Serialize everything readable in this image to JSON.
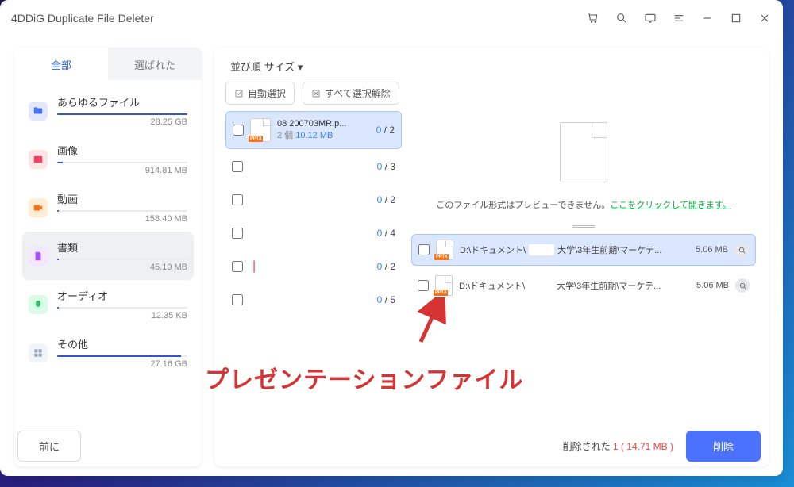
{
  "app": {
    "title": "4DDiG Duplicate File Deleter"
  },
  "tabs": {
    "all": "全部",
    "selected": "選ばれた"
  },
  "categories": [
    {
      "name": "あらゆるファイル",
      "size": "28.25 GB",
      "iconBg": "#e0e7ff",
      "iconFg": "#4a72ff",
      "fill": 100,
      "glyph": "folder"
    },
    {
      "name": "画像",
      "size": "914.81 MB",
      "iconBg": "#ffe4e6",
      "iconFg": "#f43f5e",
      "fill": 4,
      "glyph": "image"
    },
    {
      "name": "動画",
      "size": "158.40 MB",
      "iconBg": "#ffedd5",
      "iconFg": "#f97316",
      "fill": 1,
      "glyph": "video"
    },
    {
      "name": "書類",
      "size": "45.19 MB",
      "iconBg": "#f3e8ff",
      "iconFg": "#a855f7",
      "fill": 1,
      "glyph": "doc",
      "active": true
    },
    {
      "name": "オーディオ",
      "size": "12.35 KB",
      "iconBg": "#dcfce7",
      "iconFg": "#22c55e",
      "fill": 1,
      "glyph": "audio"
    },
    {
      "name": "その他",
      "size": "27.16 GB",
      "iconBg": "#f1f5f9",
      "iconFg": "#94a3b8",
      "fill": 95,
      "glyph": "other"
    }
  ],
  "sort": {
    "label": "並び順 サイズ ▾"
  },
  "actions": {
    "auto": "自動選択",
    "deselect": "すべて選択解除"
  },
  "groups": [
    {
      "name": "08   200703MR.p...",
      "count_label": "2 個",
      "size": "10.12 MB",
      "count": "0 / 2",
      "selected": true,
      "icon": true
    },
    {
      "count": "0 / 3"
    },
    {
      "count": "0 / 2"
    },
    {
      "count": "0 / 4"
    },
    {
      "count": "0 / 2",
      "red_marker": true
    },
    {
      "count": "0 / 5"
    }
  ],
  "preview": {
    "msg_prefix": "このファイル形式はプレビューできません。",
    "link": "ここをクリックして開きます。"
  },
  "files": [
    {
      "path_a": "D:\\ドキュメント\\",
      "path_b": "大学\\3年生前期\\マーケテ...",
      "size": "5.06 MB",
      "sel": true
    },
    {
      "path_a": "D:\\ドキュメント\\",
      "path_b": "大学\\3年生前期\\マーケテ...",
      "size": "5.06 MB",
      "sel": false
    }
  ],
  "footer": {
    "prev": "前に",
    "deleted_label": "削除された",
    "deleted_count": "1",
    "deleted_size": "( 14.71 MB )",
    "delete_btn": "削除"
  },
  "annotation": "プレゼンテーションファイル"
}
